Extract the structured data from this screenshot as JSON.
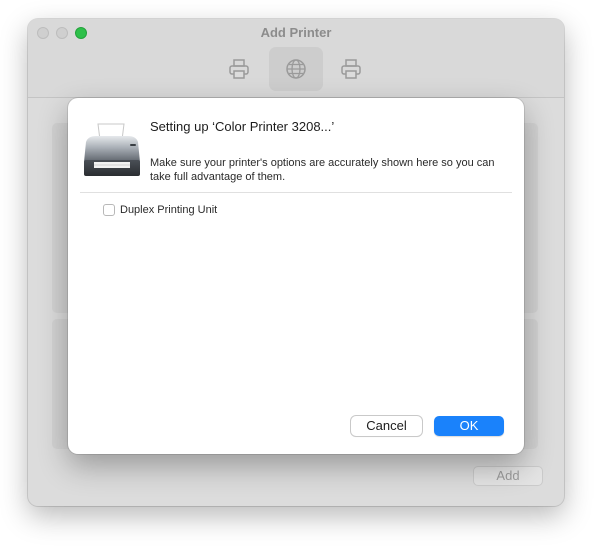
{
  "window": {
    "title": "Add Printer",
    "toolbar": [
      {
        "icon": "printer-icon"
      },
      {
        "icon": "globe-icon",
        "active": true
      },
      {
        "icon": "printer-windows-icon"
      }
    ],
    "add_button_label": "Add"
  },
  "sheet": {
    "title": "Setting up ‘Color Printer 3208...’",
    "description": "Make sure your printer's options are accurately shown here so you can take full advantage of them.",
    "options": [
      {
        "label": "Duplex Printing Unit",
        "checked": false
      }
    ],
    "cancel_label": "Cancel",
    "ok_label": "OK"
  },
  "colors": {
    "accent": "#1a82fb",
    "zoom_button": "#2ec04a"
  }
}
